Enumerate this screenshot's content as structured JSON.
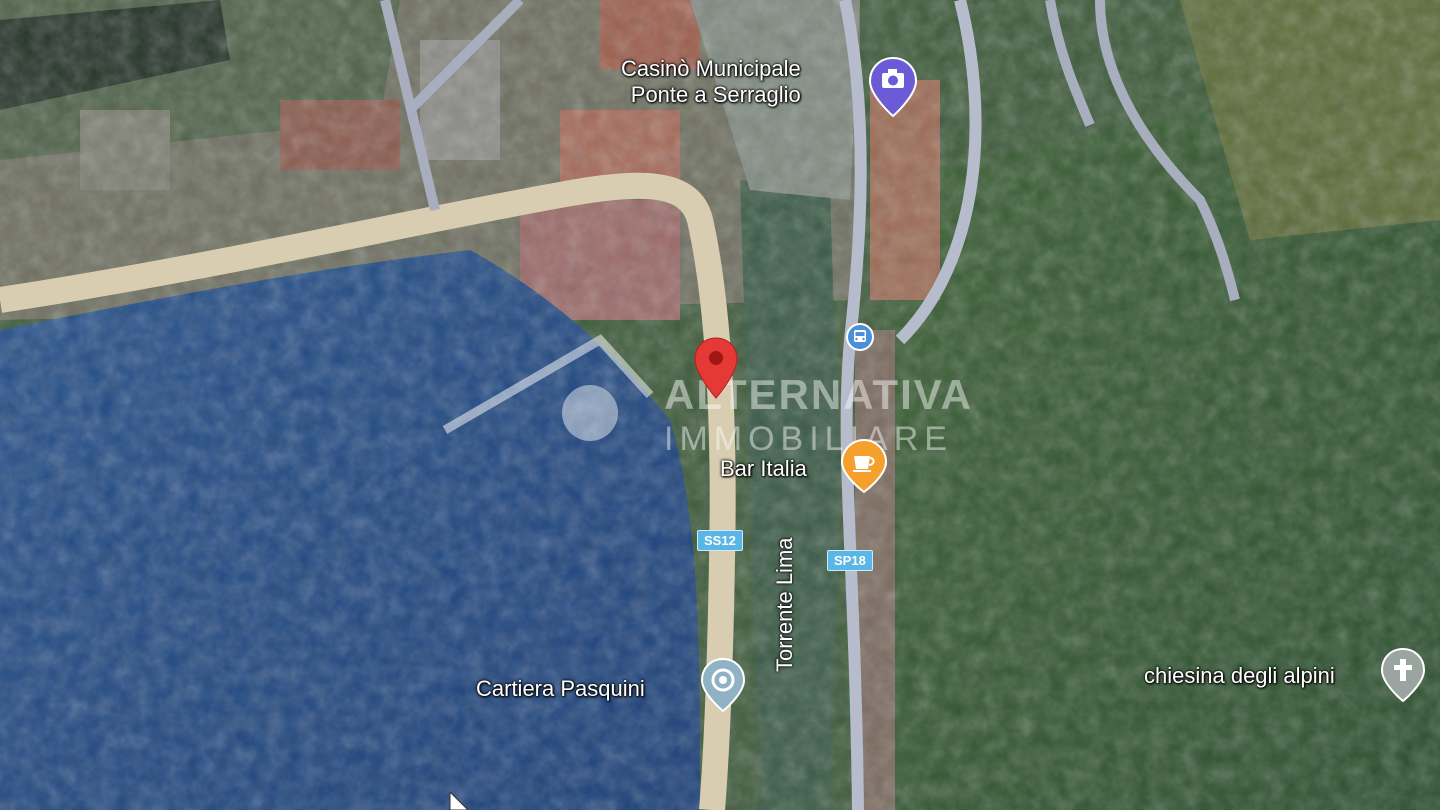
{
  "map": {
    "view": "satellite",
    "colors": {
      "water": "#1f4a86",
      "forest": "#2f5a2c",
      "road": "#d9cfb2",
      "road_secondary": "#b8bccf",
      "pin": "#e53935",
      "poi_purple": "#6b5bd6",
      "poi_orange": "#f5a02c",
      "poi_grey": "#8fb3c4",
      "shield": "#5ab6e6"
    }
  },
  "pois": {
    "casino": {
      "name_line1": "Casinò Municipale",
      "name_line2": "Ponte a Serraglio",
      "icon": "camera-icon"
    },
    "bar": {
      "name": "Bar Italia",
      "icon": "coffee-cup-icon"
    },
    "cartiera": {
      "name": "Cartiera Pasquini",
      "icon": "location-dot-icon"
    },
    "chiesina": {
      "name": "chiesina degli alpini",
      "icon": "cross-icon"
    },
    "bus_stop": {
      "icon": "bus-icon"
    }
  },
  "river": {
    "name": "Torrente Lima"
  },
  "roads": {
    "ss12": "SS12",
    "sp18": "SP18"
  },
  "watermark": {
    "line1": "ALTERNATIVA",
    "line2": "IMMOBILIARE"
  }
}
